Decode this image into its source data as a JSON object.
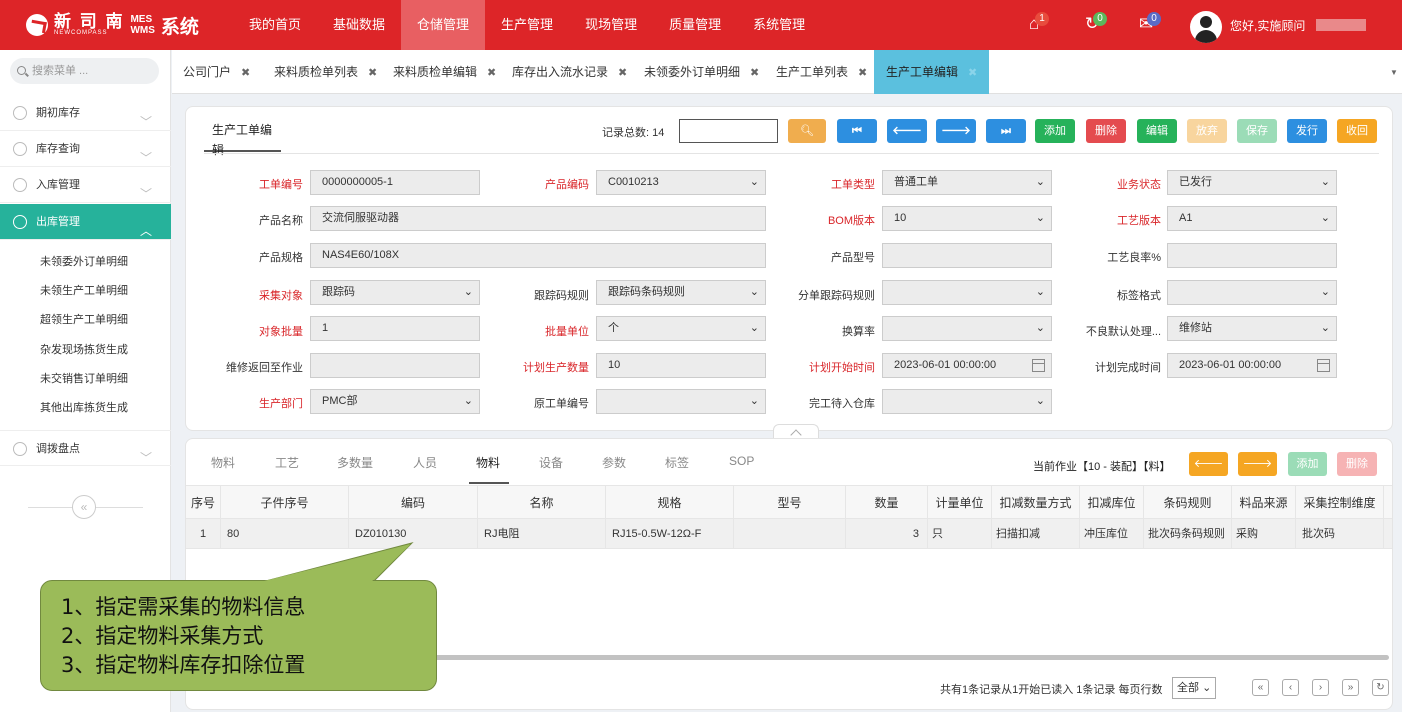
{
  "header": {
    "logo_cn": "新 司 南",
    "logo_en": "NEWCOMPASS",
    "logo_mes": "MES",
    "logo_wms": "WMS",
    "logo_sys": "系统",
    "nav": [
      "我的首页",
      "基础数据",
      "仓储管理",
      "生产管理",
      "现场管理",
      "质量管理",
      "系统管理"
    ],
    "active_nav": "仓储管理",
    "badges": {
      "home": "1",
      "clock": "0",
      "mail": "0"
    },
    "greeting": "您好,实施顾问"
  },
  "sidebar": {
    "search_placeholder": "搜索菜单 ...",
    "menus": [
      "期初库存",
      "库存查询",
      "入库管理",
      "出库管理"
    ],
    "open_menu": "出库管理",
    "subitems": [
      "未领委外订单明细",
      "未领生产工单明细",
      "超领生产工单明细",
      "杂发现场拣货生成",
      "未交销售订单明细",
      "其他出库拣货生成"
    ],
    "last_menu": "调拨盘点",
    "collapse": "«"
  },
  "tabs": [
    {
      "label": "公司门户",
      "close": "✖"
    },
    {
      "label": "来料质检单列表",
      "close": "✖"
    },
    {
      "label": "来料质检单编辑",
      "close": "✖"
    },
    {
      "label": "库存出入流水记录",
      "close": "✖"
    },
    {
      "label": "未领委外订单明细",
      "close": "✖"
    },
    {
      "label": "生产工单列表",
      "close": "✖"
    },
    {
      "label": "生产工单编辑",
      "close": "✖"
    }
  ],
  "form": {
    "title": "生产工单编辑",
    "record_total_label": "记录总数: 14",
    "buttons": {
      "add": "添加",
      "delete": "删除",
      "edit": "编辑",
      "discard": "放弃",
      "save": "保存",
      "release": "发行",
      "recall": "收回"
    },
    "labels": {
      "work_no": "工单编号",
      "product_code": "产品编码",
      "order_type": "工单类型",
      "biz_status": "业务状态",
      "product_name": "产品名称",
      "bom_ver": "BOM版本",
      "route_ver": "工艺版本",
      "product_spec": "产品规格",
      "product_model": "产品型号",
      "yield": "工艺良率%",
      "collect_obj": "采集对象",
      "track_rule": "跟踪码规则",
      "split_rule": "分单跟踪码规则",
      "label_fmt": "标签格式",
      "obj_qty": "对象批量",
      "batch_unit": "批量单位",
      "conv_rate": "换算率",
      "ng_default": "不良默认处理...",
      "repair_return": "维修返回至作业",
      "plan_qty": "计划生产数量",
      "plan_start": "计划开始时间",
      "plan_end": "计划完成时间",
      "dept": "生产部门",
      "orig_no": "原工单编号",
      "fin_wh": "完工待入仓库"
    },
    "values": {
      "work_no": "0000000005-1",
      "product_code": "C0010213",
      "order_type": "普通工单",
      "biz_status": "已发行",
      "product_name": "交流伺服驱动器",
      "bom_ver": "10",
      "route_ver": "A1",
      "product_spec": "NAS4E60/108X",
      "product_model": "",
      "yield": "",
      "collect_obj": "跟踪码",
      "track_rule": "跟踪码条码规则",
      "split_rule": "",
      "label_fmt": "",
      "obj_qty": "1",
      "batch_unit": "个",
      "conv_rate": "",
      "ng_default": "维修站",
      "repair_return": "",
      "plan_qty": "10",
      "plan_start": "2023-06-01 00:00:00",
      "plan_end": "2023-06-01 00:00:00",
      "dept": "PMC部",
      "orig_no": "",
      "fin_wh": ""
    },
    "caret": "⌄"
  },
  "detail": {
    "tabs": [
      "物料",
      "工艺",
      "多数量",
      "人员",
      "物料",
      "设备",
      "参数",
      "标签",
      "SOP"
    ],
    "active_tab_index": 4,
    "current_job": "当前作业【10 - 装配】【料】",
    "add": "添加",
    "delete": "删除",
    "columns": [
      "序号",
      "子件序号",
      "编码",
      "名称",
      "规格",
      "型号",
      "数量",
      "计量单位",
      "扣减数量方式",
      "扣减库位",
      "条码规则",
      "料品来源",
      "采集控制维度"
    ],
    "rows": [
      [
        "1",
        "80",
        "DZ010130",
        "RJ电阻",
        "RJ15-0.5W-12Ω-F",
        "",
        "3",
        "只",
        "扫描扣减",
        "冲压库位",
        "批次码条码规则",
        "采购",
        "批次码"
      ]
    ],
    "pager_text": "共有1条记录从1开始已读入 1条记录 每页行数",
    "page_size": "全部"
  },
  "callout": {
    "lines": [
      "1、指定需采集的物料信息",
      "2、指定物料采集方式",
      "3、指定物料库存扣除位置"
    ]
  },
  "colors": {
    "topbar": "#dd2528",
    "active_nav": "#e85f62",
    "menu_active": "#26b29b",
    "tab_active": "#5bc0de",
    "callout": "#9bbb59"
  }
}
